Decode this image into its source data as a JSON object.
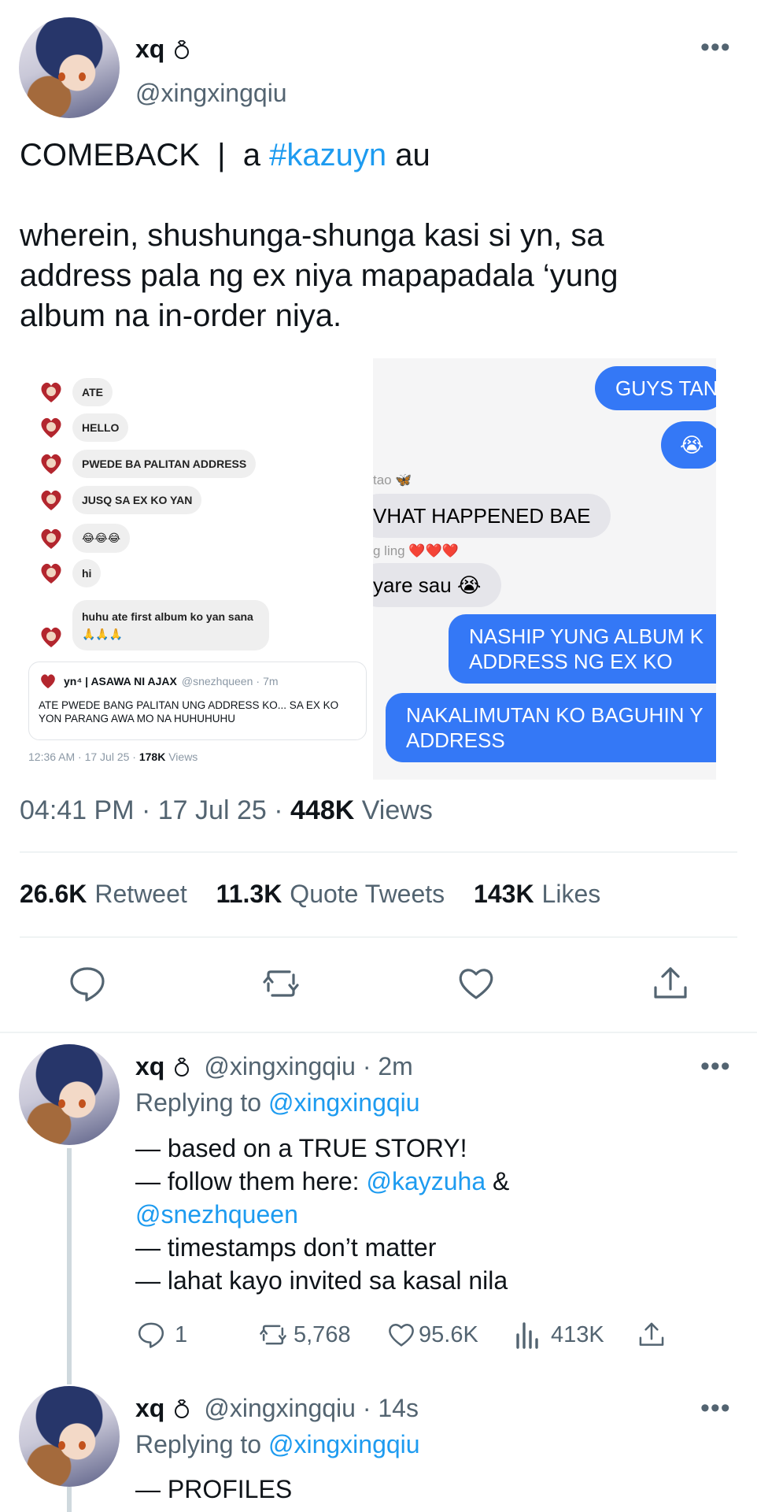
{
  "main_tweet": {
    "display_name": "xq",
    "handle": "@xingxingqiu",
    "text_prefix": "COMEBACK  |  a ",
    "hashtag": "#kazuyn",
    "text_suffix": " au",
    "body_line1": "wherein, shushunga-shunga kasi si yn, sa",
    "body_line2": "address pala ng ex niya mapapadala ‘yung",
    "body_line3": "album na in-order niya.",
    "time": "04:41 PM",
    "date": "17 Jul 25",
    "views_count": "448K",
    "views_label": "Views",
    "retweets_count": "26.6K",
    "retweets_label": "Retweet",
    "quotes_count": "11.3K",
    "quotes_label": "Quote Tweets",
    "likes_count": "143K",
    "likes_label": "Likes"
  },
  "image_left": {
    "messages": [
      "ATE",
      "HELLO",
      "PWEDE BA PALITAN ADDRESS",
      "JUSQ SA EX KO YAN",
      "😂😂😂",
      "hi",
      "huhu ate first album ko yan sana",
      "🙏🙏🙏"
    ],
    "quote_name": "yn⁴ | ASAWA NI AJAX",
    "quote_handle": "@snezhqueen",
    "quote_time": "7m",
    "quote_text": "ATE PWEDE BANG PALITAN UNG ADDRESS KO... SA EX KO YON PARANG AWA MO NA HUHUHUHU",
    "footer_time": "12:36 AM · 17 Jul 25 · ",
    "footer_views_count": "178K",
    "footer_views_label": "Views"
  },
  "image_right": {
    "bubble1": "GUYS TAN",
    "bubble2": "😭",
    "sender1": "tao 🦋",
    "bubble3": "VHAT HAPPENED BAE",
    "sender2": "g ling ❤️❤️❤️",
    "bubble4": "yare sau 😭",
    "bubble5_l1": "NASHIP YUNG ALBUM K",
    "bubble5_l2": "ADDRESS NG EX KO",
    "bubble6_l1": "NAKALIMUTAN KO BAGUHIN Y",
    "bubble6_l2": "ADDRESS"
  },
  "reply1": {
    "display_name": "xq",
    "handle_time": "@xingxingqiu · 2m",
    "replying_label": "Replying to ",
    "replying_to": "@xingxingqiu",
    "line1": "— based on a TRUE STORY!",
    "line2_prefix": "— follow them here: ",
    "mention1": "@kayzuha",
    "line2_suffix": " &",
    "mention2": "@snezhqueen",
    "line3": "— timestamps don’t matter",
    "line4": "— lahat kayo invited sa kasal nila",
    "replies": "1",
    "retweets": "5,768",
    "likes": "95.6K",
    "views": "413K"
  },
  "reply2": {
    "display_name": "xq",
    "handle_time": "@xingxingqiu · 14s",
    "replying_label": "Replying to ",
    "replying_to": "@xingxingqiu",
    "line1": "— PROFILES"
  },
  "icons": {
    "reply": "speech-bubble-icon",
    "retweet": "retweet-icon",
    "like": "heart-icon",
    "share": "share-icon",
    "views": "bar-chart-icon",
    "more": "more-dots-icon",
    "badge": "ring-icon"
  },
  "colors": {
    "link": "#1d9bf0",
    "imessage_blue": "#3478f6"
  }
}
